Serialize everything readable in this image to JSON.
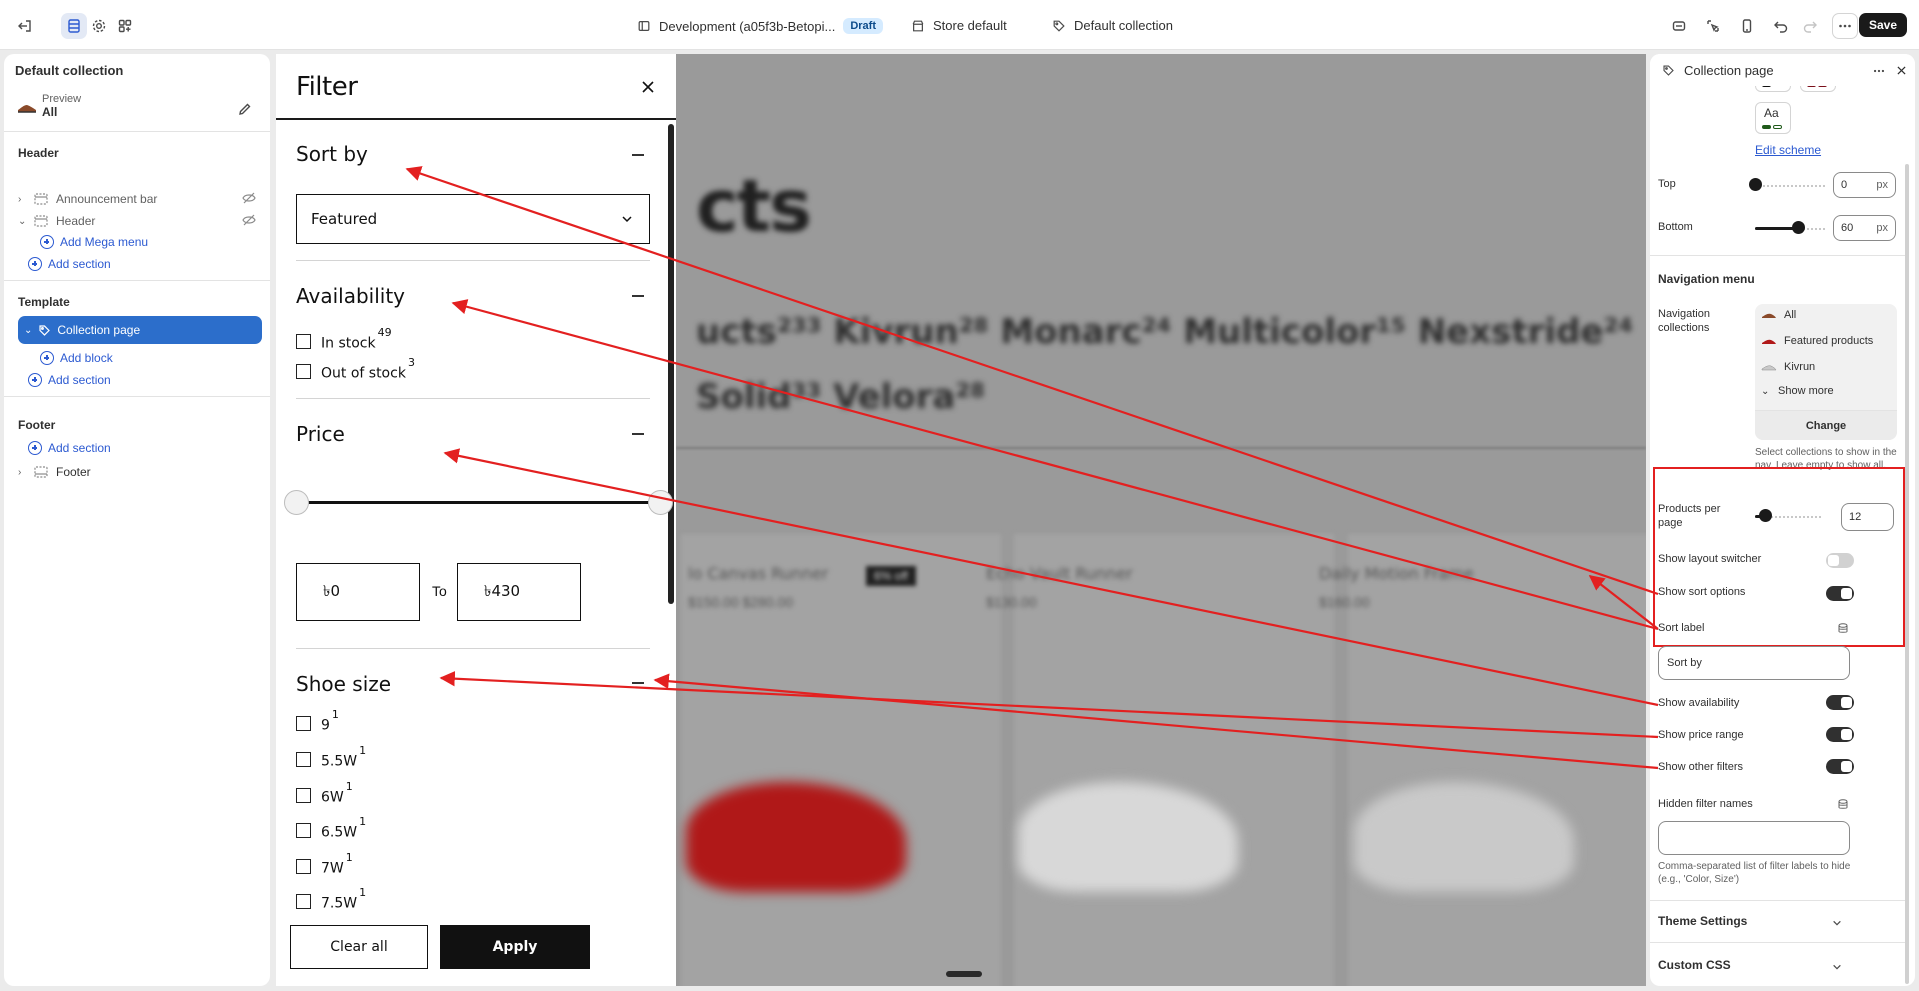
{
  "topbar": {
    "store_name": "Development (a05f3b-Betopi...",
    "draft_badge": "Draft",
    "store_default": "Store default",
    "collection": "Default collection",
    "save_label": "Save"
  },
  "left_panel": {
    "title": "Default collection",
    "preview_label": "Preview",
    "preview_value": "All",
    "header_group": "Header",
    "announcement_bar": "Announcement bar",
    "header_item": "Header",
    "add_mega_menu": "Add Mega menu",
    "add_section_1": "Add section",
    "template_group": "Template",
    "collection_page": "Collection page",
    "add_block": "Add block",
    "add_section_2": "Add section",
    "footer_group": "Footer",
    "add_section_3": "Add section",
    "footer_item": "Footer"
  },
  "preview": {
    "heading": "cts",
    "tabs_row1": "ucts²³³  Kivrun²⁸  Monarc²⁴  Multicolor¹⁵  Nexstride²⁴",
    "tabs_row2": "Solid³³  Velora²⁸",
    "card1_title": "lo Canvas Runner",
    "card1_price": "$150.00 $280.00",
    "card1_badge": "6% off",
    "card2_title": "Echo Vault Runner",
    "card2_price": "$130.00",
    "card3_title": "Daily Motion Frame",
    "card3_price": "$160.00"
  },
  "filter_drawer": {
    "title": "Filter",
    "sort_title": "Sort by",
    "sort_value": "Featured",
    "availability_title": "Availability",
    "in_stock": "In stock",
    "in_stock_count": "49",
    "out_of_stock": "Out of stock",
    "out_of_stock_count": "3",
    "price_title": "Price",
    "price_from": "৳0",
    "price_to_label": "To",
    "price_to": "৳430",
    "shoe_size_title": "Shoe size",
    "sizes": [
      {
        "label": "9",
        "count": "1"
      },
      {
        "label": "5.5W",
        "count": "1"
      },
      {
        "label": "6W",
        "count": "1"
      },
      {
        "label": "6.5W",
        "count": "1"
      },
      {
        "label": "7W",
        "count": "1"
      },
      {
        "label": "7.5W",
        "count": "1"
      }
    ],
    "clear_all": "Clear all",
    "apply": "Apply"
  },
  "right_panel": {
    "title": "Collection page",
    "aa": "Aa",
    "edit_scheme": "Edit scheme",
    "top_label": "Top",
    "top_value": "0",
    "top_level": 0,
    "bottom_label": "Bottom",
    "bottom_value": "60",
    "bottom_level": 0.6,
    "unit": "px",
    "nav_menu_title": "Navigation menu",
    "nav_collections_label": "Navigation collections",
    "nav_items": [
      "All",
      "Featured products",
      "Kivrun"
    ],
    "show_more": "Show more",
    "change": "Change",
    "nav_help": "Select collections to show in the nav. Leave empty to show all.",
    "products_per_page_label": "Products per page",
    "products_per_page": "12",
    "products_per_page_level": 0.15,
    "show_layout_switcher": "Show layout switcher",
    "show_layout_switcher_on": false,
    "show_sort_options": "Show sort options",
    "show_sort_options_on": true,
    "sort_label": "Sort label",
    "sort_label_value": "Sort by",
    "show_availability": "Show availability",
    "show_availability_on": true,
    "show_price_range": "Show price range",
    "show_price_range_on": true,
    "show_other_filters": "Show other filters",
    "show_other_filters_on": true,
    "hidden_filter_names": "Hidden filter names",
    "hidden_filter_value": "",
    "hidden_help": "Comma-separated list of filter labels to hide (e.g., 'Color, Size')",
    "theme_settings": "Theme Settings",
    "custom_css": "Custom CSS"
  },
  "colors": {
    "accent": "#2c6ecb",
    "annotation": "#e32020",
    "dark": "#1a1a1a"
  }
}
